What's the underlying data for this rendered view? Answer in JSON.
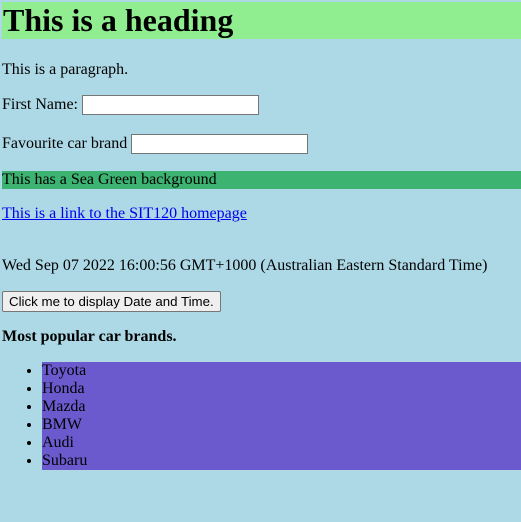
{
  "heading": "This is a heading",
  "paragraph": "This is a paragraph.",
  "form": {
    "first_name_label": "First Name:",
    "first_name_value": "",
    "car_brand_label": "Favourite car brand",
    "car_brand_value": ""
  },
  "sea_green_text": "This has a Sea Green background",
  "link_text": "This is a link to the SIT120 homepage",
  "datetime_text": "Wed Sep 07 2022 16:00:56 GMT+1000 (Australian Eastern Standard Time)",
  "button_label": "Click me to display Date and Time.",
  "list_title": "Most popular car brands.",
  "car_brands": [
    "Toyota",
    "Honda",
    "Mazda",
    "BMW",
    "Audi",
    "Subaru"
  ],
  "colors": {
    "page_background": "#add8e6",
    "heading_background": "#90ee90",
    "sea_green": "#3cb371",
    "list_background": "#6a5acd",
    "link": "#0000ee"
  }
}
